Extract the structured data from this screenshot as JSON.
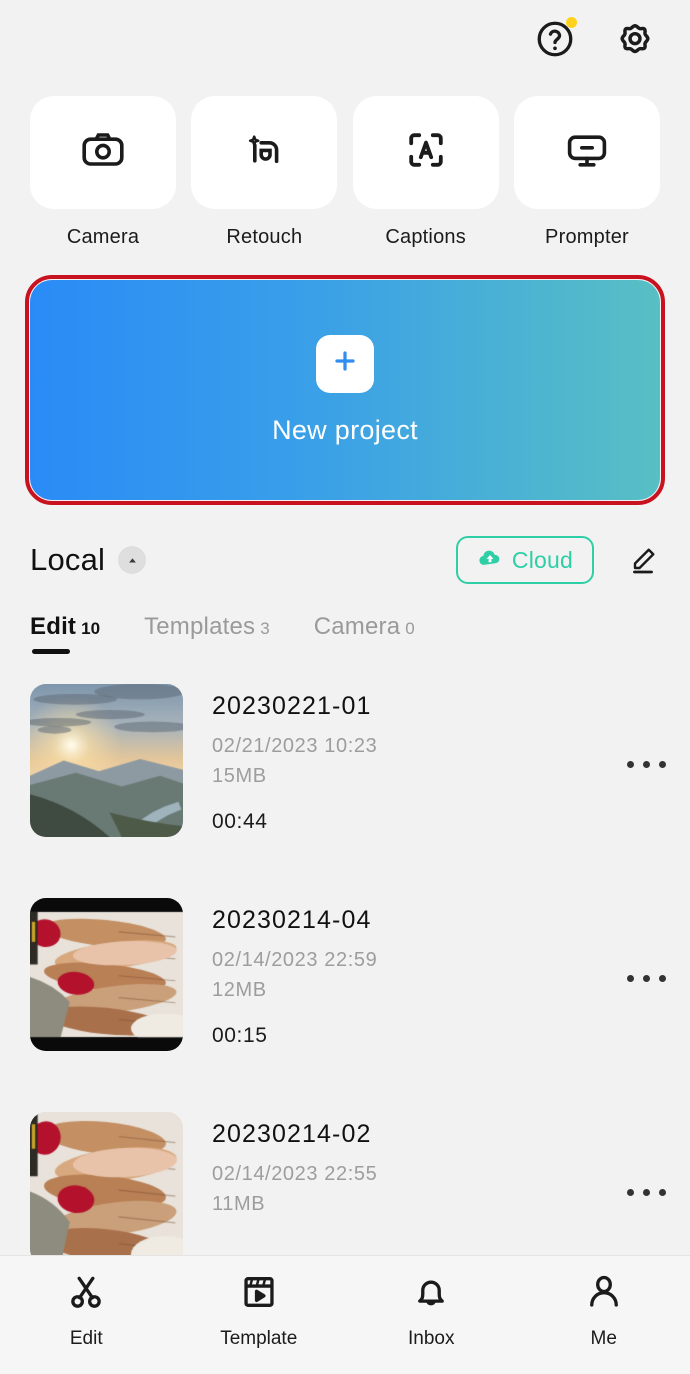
{
  "header": {
    "help_icon": "help-circle-icon",
    "help_badge": true,
    "settings_icon": "gear-icon"
  },
  "features": [
    {
      "label": "Camera",
      "icon": "camera-icon"
    },
    {
      "label": "Retouch",
      "icon": "retouch-face-sparkle-icon"
    },
    {
      "label": "Captions",
      "icon": "captions-scan-a-icon"
    },
    {
      "label": "Prompter",
      "icon": "prompter-monitor-icon"
    }
  ],
  "banner": {
    "label": "New project",
    "plus_icon": "plus-icon",
    "gradient_from": "#2a8bf6",
    "gradient_to": "#58bfc4",
    "highlight_color": "#c9121f"
  },
  "library": {
    "source_label": "Local",
    "collapse_icon": "chevron-up-icon",
    "cloud_label": "Cloud",
    "cloud_icon": "cloud-upload-icon",
    "cloud_color": "#2ecfa6",
    "edit_icon": "pencil-icon"
  },
  "tabs": [
    {
      "label": "Edit",
      "count": "10",
      "active": true
    },
    {
      "label": "Templates",
      "count": "3",
      "active": false
    },
    {
      "label": "Camera",
      "count": "0",
      "active": false
    }
  ],
  "projects": [
    {
      "title": "20230221-01",
      "datetime": "02/21/2023 10:23",
      "size": "15MB",
      "duration": "00:44",
      "thumb": "sunset-mountains",
      "more_icon": "more-horizontal-icon"
    },
    {
      "title": "20230214-04",
      "datetime": "02/14/2023 22:59",
      "size": "12MB",
      "duration": "00:15",
      "thumb": "stacked-hands",
      "more_icon": "more-horizontal-icon"
    },
    {
      "title": "20230214-02",
      "datetime": "02/14/2023 22:55",
      "size": "11MB",
      "duration": "",
      "thumb": "stacked-hands",
      "more_icon": "more-horizontal-icon"
    }
  ],
  "bottom_nav": [
    {
      "label": "Edit",
      "icon": "scissors-icon"
    },
    {
      "label": "Template",
      "icon": "clapperboard-play-icon"
    },
    {
      "label": "Inbox",
      "icon": "bell-icon"
    },
    {
      "label": "Me",
      "icon": "person-icon"
    }
  ]
}
